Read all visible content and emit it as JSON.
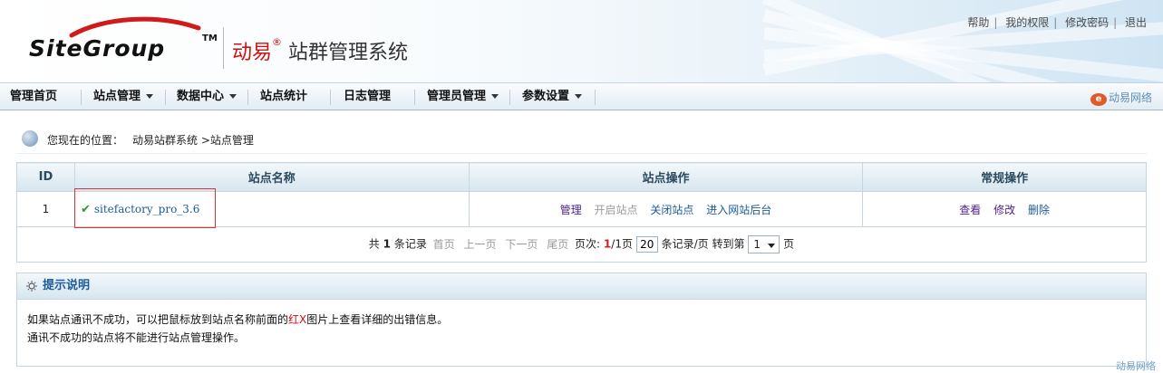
{
  "header": {
    "logo_text": "SiteGroup",
    "logo_tm": "TM",
    "brand_red": "动易",
    "brand_reg": "®",
    "brand_title": "站群管理系统",
    "top_links": [
      "帮助",
      "我的权限",
      "修改密码",
      "退出"
    ]
  },
  "nav": {
    "items": [
      {
        "label": "管理首页",
        "dropdown": false
      },
      {
        "label": "站点管理",
        "dropdown": true
      },
      {
        "label": "数据中心",
        "dropdown": true
      },
      {
        "label": "站点统计",
        "dropdown": false
      },
      {
        "label": "日志管理",
        "dropdown": false
      },
      {
        "label": "管理员管理",
        "dropdown": true
      },
      {
        "label": "参数设置",
        "dropdown": true
      }
    ],
    "right_brand": "动易网络"
  },
  "breadcrumb": {
    "prefix": "您现在的位置：",
    "path": "动易站群系统 >站点管理"
  },
  "table": {
    "headers": [
      "ID",
      "站点名称",
      "站点操作",
      "常规操作"
    ],
    "rows": [
      {
        "id": "1",
        "name": "sitefactory_pro_3.6",
        "site_ops": [
          "管理",
          "开启站点",
          "关闭站点",
          "进入网站后台"
        ],
        "common_ops": [
          "查看",
          "修改",
          "删除"
        ]
      }
    ],
    "pager": {
      "total_prefix": "共",
      "total": "1",
      "total_suffix": "条记录",
      "first": "首页",
      "prev": "上一页",
      "next": "下一页",
      "last": "尾页",
      "page_label": "页次:",
      "current": "1",
      "total_pages": "/1页",
      "page_size": "20",
      "per_page_label": "条记录/页",
      "goto_label": "转到第",
      "goto_value": "1",
      "page_suffix": "页"
    }
  },
  "tip": {
    "title": "提示说明",
    "line1_a": "如果站点通讯不成功，可以把鼠标放到站点名称前面的",
    "line1_red": "红X",
    "line1_b": "图片上查看详细的出错信息。",
    "line2": "通讯不成功的站点将不能进行站点管理操作。"
  },
  "footer_brand": "动易网络"
}
